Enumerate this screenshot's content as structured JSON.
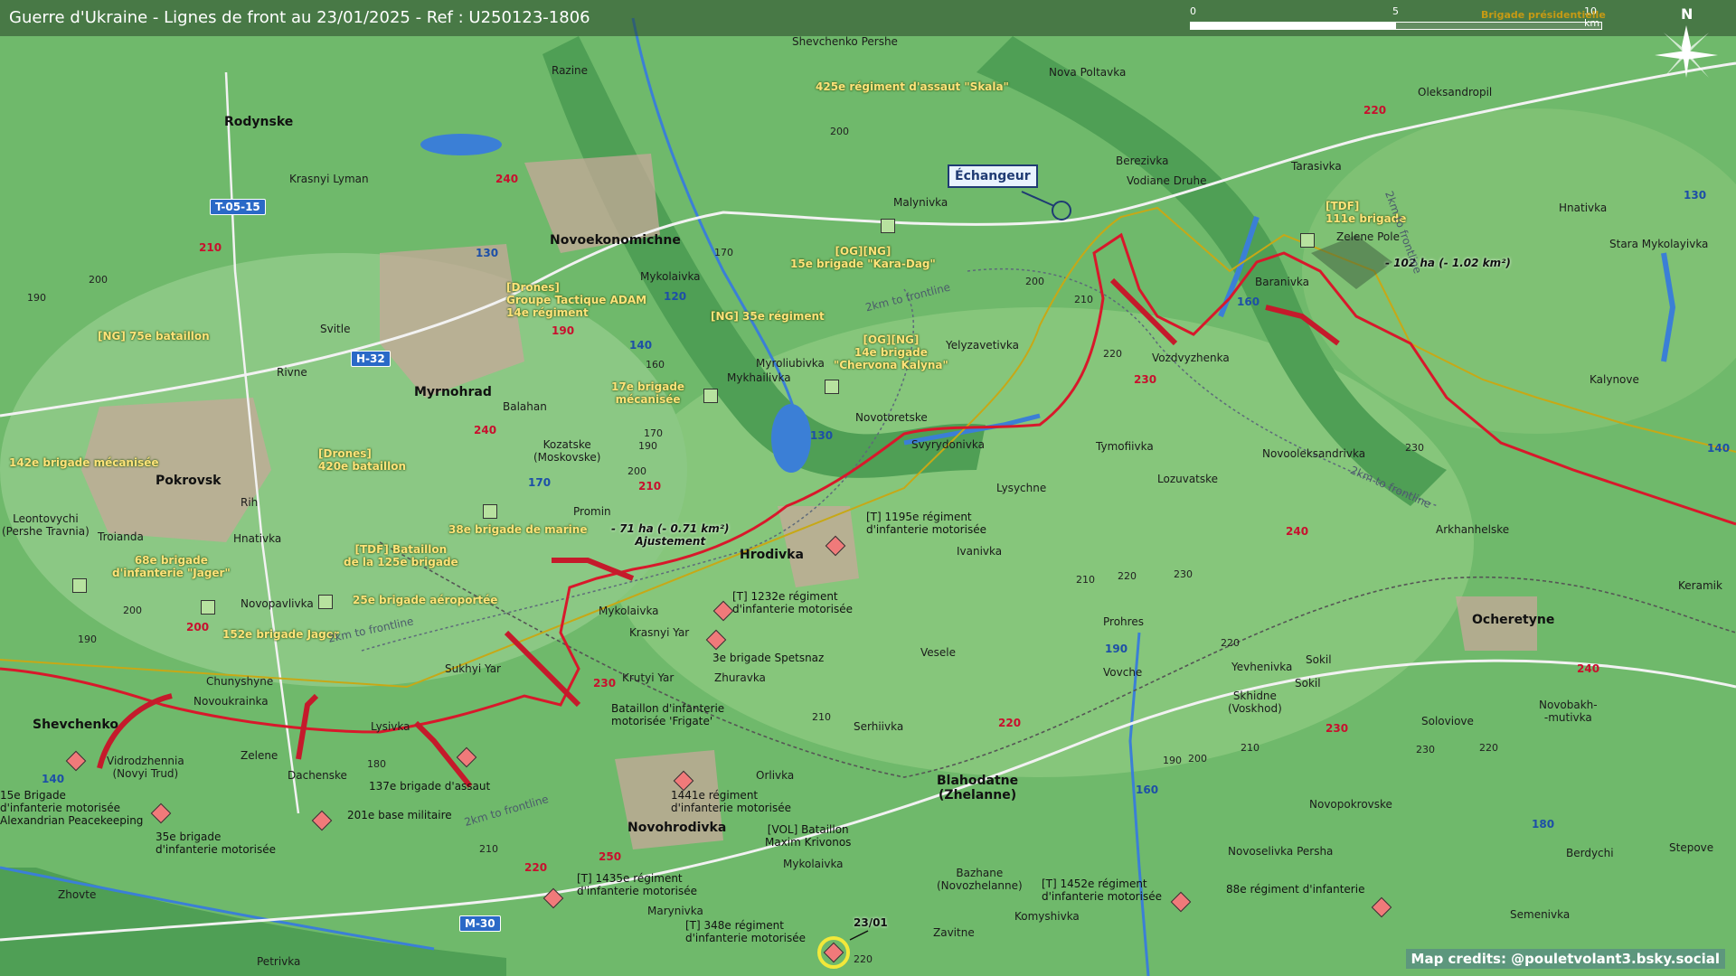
{
  "title": "Guerre d'Ukraine - Lignes de front au 23/01/2025 - Ref : U250123-1806",
  "scale": {
    "labels": [
      "0",
      "5",
      "10 km"
    ],
    "overlay": "Brigade présidentielle"
  },
  "north_label": "N",
  "credits": "Map credits: @pouletvolant3.bsky.social",
  "colors": {
    "terrain": "#6db86a",
    "front_line": "#d8182b",
    "ua_zone_line": "#c7a816",
    "water": "#3b7fd6",
    "road_badge": "#2a69c7"
  },
  "towns": [
    {
      "name": "Rodynske",
      "big": true
    },
    {
      "name": "Novoekonomichne",
      "big": true
    },
    {
      "name": "Myrnohrad",
      "big": true
    },
    {
      "name": "Pokrovsk",
      "big": true
    },
    {
      "name": "Hrodivka",
      "big": true
    },
    {
      "name": "Shevchenko",
      "big": true
    },
    {
      "name": "Novohrodivka",
      "big": true
    },
    {
      "name": "Ocheretyne",
      "big": true
    },
    {
      "name": "Blahodatne\n(Zhelanne)",
      "big": true
    },
    {
      "name": "Shevchenko Pershe"
    },
    {
      "name": "Razine"
    },
    {
      "name": "Nova Poltavka"
    },
    {
      "name": "Oleksandropil"
    },
    {
      "name": "Krasnyi Lyman"
    },
    {
      "name": "Malynivka"
    },
    {
      "name": "Berezivka"
    },
    {
      "name": "Vodiane Druhe"
    },
    {
      "name": "Tarasivka"
    },
    {
      "name": "Hnativka"
    },
    {
      "name": "Stara Mykolayivka"
    },
    {
      "name": "Zelene Pole"
    },
    {
      "name": "Baranivka"
    },
    {
      "name": "Vozdvyzhenka"
    },
    {
      "name": "Mykolaivka"
    },
    {
      "name": "Svitle"
    },
    {
      "name": "Rivne"
    },
    {
      "name": "Myroliubivka"
    },
    {
      "name": "Mykhailivka"
    },
    {
      "name": "Yelyzavetivka"
    },
    {
      "name": "Kalynove"
    },
    {
      "name": "Balahan"
    },
    {
      "name": "Novotoretske"
    },
    {
      "name": "Svyrydonivka"
    },
    {
      "name": "Tymofiivka"
    },
    {
      "name": "Novooleksandrivka"
    },
    {
      "name": "Kozatske\n(Moskovske)"
    },
    {
      "name": "Lysychne"
    },
    {
      "name": "Lozuvatske"
    },
    {
      "name": "Rih"
    },
    {
      "name": "Leontovychi\n(Pershe Travnia)"
    },
    {
      "name": "Troianda"
    },
    {
      "name": "Hnativka"
    },
    {
      "name": "Promin"
    },
    {
      "name": "Arkhanhelske"
    },
    {
      "name": "Ivanivka"
    },
    {
      "name": "Keramik"
    },
    {
      "name": "Novopavlivka"
    },
    {
      "name": "Mykolaivka"
    },
    {
      "name": "Krasnyi Yar"
    },
    {
      "name": "Prohres"
    },
    {
      "name": "Vesele"
    },
    {
      "name": "Chunyshyne"
    },
    {
      "name": "Novoukrainka"
    },
    {
      "name": "Sukhyi Yar"
    },
    {
      "name": "Krutyi Yar"
    },
    {
      "name": "Zhuravka"
    },
    {
      "name": "Vovche"
    },
    {
      "name": "Yevhenivka"
    },
    {
      "name": "Sokil"
    },
    {
      "name": "Skhidne\n(Voskhod)"
    },
    {
      "name": "Soloviove"
    },
    {
      "name": "Novobakh-\n-mutivka"
    },
    {
      "name": "Lysivka"
    },
    {
      "name": "Zelene"
    },
    {
      "name": "Dachenske"
    },
    {
      "name": "Vidrodzhennia\n(Novyi Trud)"
    },
    {
      "name": "Serhiivka"
    },
    {
      "name": "Orlivka"
    },
    {
      "name": "Novopokrovske"
    },
    {
      "name": "Berdychi"
    },
    {
      "name": "Stepove"
    },
    {
      "name": "Novoselivka Persha"
    },
    {
      "name": "Mykolaivka"
    },
    {
      "name": "Bazhane\n(Novozhelanne)"
    },
    {
      "name": "Komyshivka"
    },
    {
      "name": "Semenivka"
    },
    {
      "name": "Zhovte"
    },
    {
      "name": "Marynivka"
    },
    {
      "name": "Zavitne"
    },
    {
      "name": "Petrivka"
    },
    {
      "name": "Sokil"
    }
  ],
  "ua_units": [
    "425e régiment d'assaut \"Skala\"",
    "[OG][NG]\n15e brigade \"Kara-Dag\"",
    "[Drones]\nGroupe Tactique ADAM\n14e régiment",
    "[NG] 35e régiment",
    "[NG] 75e bataillon",
    "[OG][NG]\n14e brigade\n\"Chervona Kalyna\"",
    "17e brigade\nmécanisée",
    "142e brigade mécanisée",
    "[Drones]\n420e bataillon",
    "38e brigade de marine",
    "68e brigade\nd'infanterie \"Jager\"",
    "[TDF] Bataillon\nde la 125e brigade",
    "25e brigade aéroportée",
    "152e brigade Jager",
    "[TDF]\n111e brigade"
  ],
  "ru_units": [
    "[T] 1195e régiment\nd'infanterie motorisée",
    "[T] 1232e régiment\nd'infanterie motorisée",
    "3e brigade Spetsnaz",
    "Bataillon d'infanterie\nmotorisée 'Frigate'",
    "137e brigade d'assaut",
    "201e base militaire",
    "15e Brigade\nd'infanterie motorisée\nAlexandrian Peacekeeping",
    "35e brigade\nd'infanterie motorisée",
    "1441e régiment\nd'infanterie motorisée",
    "[VOL] Bataillon\nMaxim Krivonos",
    "[T] 1435e régiment\nd'infanterie motorisée",
    "[T] 348e régiment\nd'infanterie motorisée",
    "[T] 1452e régiment\nd'infanterie motorisée",
    "88e régiment d'infanterie"
  ],
  "annotations": {
    "loss_east": "- 102 ha (- 1.02 km²)",
    "loss_west": "- 71 ha (- 0.71 km²)\nAjustement",
    "date_marker": "23/01",
    "echangeur": "Échangeur",
    "frontline": "2km to frontline"
  },
  "roads": [
    "T-05-15",
    "H-32",
    "M-30"
  ],
  "highways": [
    "240",
    "210",
    "190",
    "140",
    "130",
    "120",
    "170",
    "200",
    "250",
    "220",
    "230",
    "160",
    "180"
  ],
  "elevations": [
    "200",
    "190",
    "170",
    "160",
    "180",
    "210",
    "220",
    "230"
  ]
}
